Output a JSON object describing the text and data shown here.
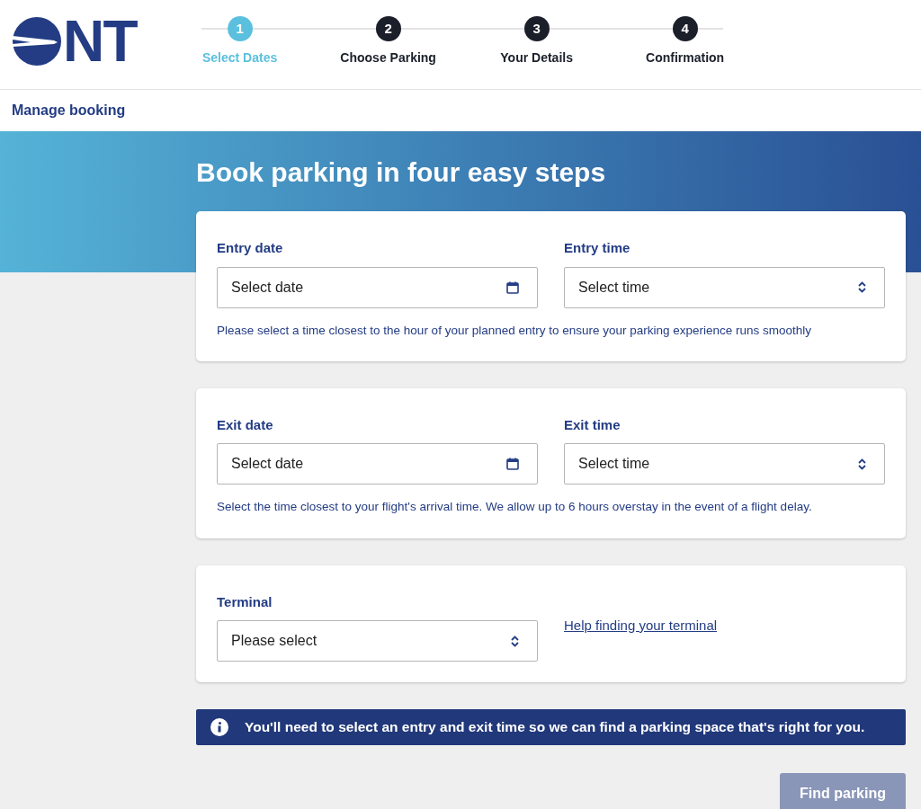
{
  "logo": {
    "text": "NT"
  },
  "steps": [
    {
      "number": "1",
      "label": "Select Dates",
      "selected": true
    },
    {
      "number": "2",
      "label": "Choose Parking",
      "selected": false
    },
    {
      "number": "3",
      "label": "Your Details",
      "selected": false
    },
    {
      "number": "4",
      "label": "Confirmation",
      "selected": false
    }
  ],
  "manage_booking": "Manage booking",
  "heading": "Book parking in four easy steps",
  "cards": [
    {
      "fields": [
        {
          "kind": "date",
          "label": "Entry date",
          "placeholder": "Select date"
        },
        {
          "kind": "select",
          "label": "Entry time",
          "placeholder": "Select time"
        }
      ],
      "hint": "Please select a time closest to the hour of your planned entry to ensure your parking experience runs smoothly"
    },
    {
      "fields": [
        {
          "kind": "date",
          "label": "Exit date",
          "placeholder": "Select date"
        },
        {
          "kind": "select",
          "label": "Exit time",
          "placeholder": "Select time"
        }
      ],
      "hint": "Select the time closest to your flight's arrival time. We allow up to 6 hours overstay in the event of a flight delay."
    },
    {
      "fields": [
        {
          "kind": "select",
          "label": "Terminal",
          "placeholder": "Please select"
        },
        {
          "kind": "link",
          "label": "Help finding your terminal"
        }
      ]
    }
  ],
  "notice": "You'll need to select an entry and exit time so we can find a parking space that's right for you.",
  "submit": {
    "label": "Find parking",
    "disabled": true
  }
}
